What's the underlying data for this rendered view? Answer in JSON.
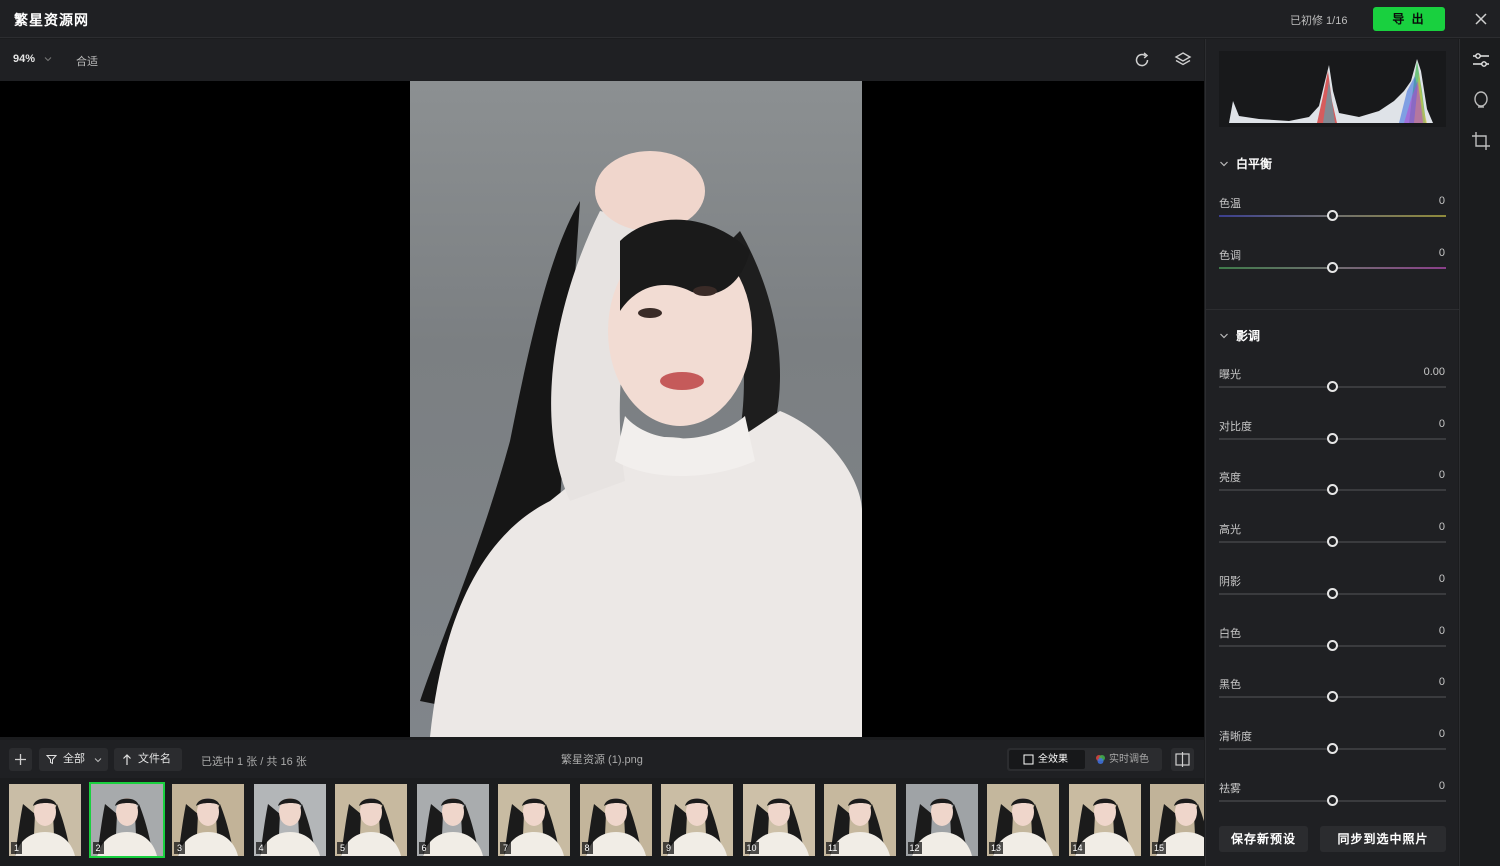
{
  "app": {
    "title": "繁星资源网"
  },
  "header": {
    "edited_count": "已初修 1/16",
    "export_label": "导 出"
  },
  "toolbar": {
    "zoom": "94%",
    "fit_label": "合适"
  },
  "filmstrip_bar": {
    "filter_label": "全部",
    "sort_label": "文件名",
    "selection_count": "已选中 1 张 / 共 16 张",
    "file_name": "繁星资源 (1).png",
    "full_effect_label": "全效果",
    "live_color_label": "实时调色"
  },
  "thumbnails": [
    {
      "num": "1",
      "bg": "#c9bda6"
    },
    {
      "num": "2",
      "bg": "#a7aaac"
    },
    {
      "num": "3",
      "bg": "#c2b398"
    },
    {
      "num": "4",
      "bg": "#b3b6b8"
    },
    {
      "num": "5",
      "bg": "#c7b99f"
    },
    {
      "num": "6",
      "bg": "#a9acae"
    },
    {
      "num": "7",
      "bg": "#c8bba2"
    },
    {
      "num": "8",
      "bg": "#c3b59b"
    },
    {
      "num": "9",
      "bg": "#cabda4"
    },
    {
      "num": "10",
      "bg": "#cdc0a8"
    },
    {
      "num": "11",
      "bg": "#c6b89e"
    },
    {
      "num": "12",
      "bg": "#9fa3a6"
    },
    {
      "num": "13",
      "bg": "#c4b79d"
    },
    {
      "num": "14",
      "bg": "#c9bba1"
    },
    {
      "num": "15",
      "bg": "#c1b399"
    }
  ],
  "selected_thumbnail": "2",
  "panel": {
    "white_balance": {
      "title": "白平衡",
      "sliders": [
        {
          "label": "色温",
          "value": "0",
          "level": 0.5
        },
        {
          "label": "色调",
          "value": "0",
          "level": 0.5
        }
      ]
    },
    "tone": {
      "title": "影调",
      "sliders": [
        {
          "label": "曝光",
          "value": "0.00",
          "level": 0.5
        },
        {
          "label": "对比度",
          "value": "0",
          "level": 0.5
        },
        {
          "label": "亮度",
          "value": "0",
          "level": 0.5
        },
        {
          "label": "高光",
          "value": "0",
          "level": 0.5
        },
        {
          "label": "阴影",
          "value": "0",
          "level": 0.5
        },
        {
          "label": "白色",
          "value": "0",
          "level": 0.5
        },
        {
          "label": "黑色",
          "value": "0",
          "level": 0.5
        },
        {
          "label": "清晰度",
          "value": "0",
          "level": 0.5
        },
        {
          "label": "祛雾",
          "value": "0",
          "level": 0.5
        }
      ]
    },
    "save_preset_label": "保存新预设",
    "sync_label": "同步到选中照片"
  },
  "colors": {
    "accent": "#19d03f",
    "background": "#1f2023"
  }
}
